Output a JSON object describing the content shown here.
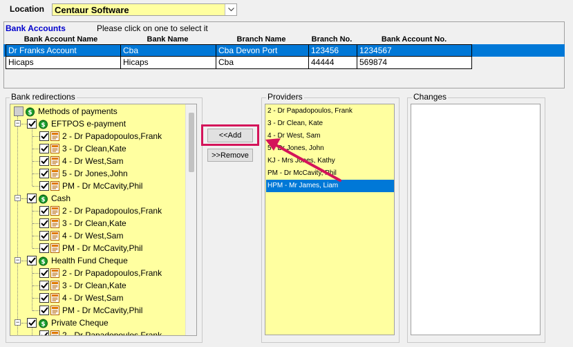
{
  "location": {
    "label": "Location",
    "value": "Centaur Software"
  },
  "bank_accounts": {
    "title": "Bank Accounts",
    "hint": "Please click on one to select it",
    "columns": [
      "Bank Account Name",
      "Bank Name",
      "Branch Name",
      "Branch No.",
      "Bank Account No."
    ],
    "rows": [
      {
        "account_name": "Dr Franks Account",
        "bank_name": "Cba",
        "branch_name": "Cba Devon Port",
        "branch_no": "123456",
        "account_no": "1234567",
        "selected": true
      },
      {
        "account_name": "Hicaps",
        "bank_name": "Hicaps",
        "branch_name": "Cba",
        "branch_no": "44444",
        "account_no": "569874",
        "selected": false
      }
    ]
  },
  "redirections": {
    "label": "Bank redirections",
    "root": "Methods of payments",
    "groups": [
      {
        "name": "EFTPOS e-payment",
        "items": [
          "2 - Dr Papadopoulos,Frank",
          "3 - Dr Clean,Kate",
          "4 - Dr West,Sam",
          "5 - Dr Jones,John",
          "PM - Dr McCavity,Phil"
        ]
      },
      {
        "name": "Cash",
        "items": [
          "2 - Dr Papadopoulos,Frank",
          "3 - Dr Clean,Kate",
          "4 - Dr West,Sam",
          "PM - Dr McCavity,Phil"
        ]
      },
      {
        "name": "Health Fund Cheque",
        "items": [
          "2 - Dr Papadopoulos,Frank",
          "3 - Dr Clean,Kate",
          "4 - Dr West,Sam",
          "PM - Dr McCavity,Phil"
        ]
      },
      {
        "name": "Private Cheque",
        "items": [
          "2 - Dr Papadopoulos,Frank"
        ]
      }
    ]
  },
  "buttons": {
    "add": "<<Add",
    "remove": ">>Remove"
  },
  "providers": {
    "label": "Providers",
    "items": [
      "2 - Dr Papadopoulos, Frank",
      "3 - Dr Clean, Kate",
      "4 - Dr West, Sam",
      "5 - Dr Jones, John",
      "KJ - Mrs Jones, Kathy",
      "PM - Dr McCavity, Phil",
      "HPM - Mr James, Liam"
    ],
    "selected_index": 6
  },
  "changes": {
    "label": "Changes"
  },
  "colors": {
    "field_yellow": "#ffffa0",
    "selection_blue": "#0078d7",
    "annotation_pink": "#d4145a",
    "title_blue": "#0000cc"
  }
}
